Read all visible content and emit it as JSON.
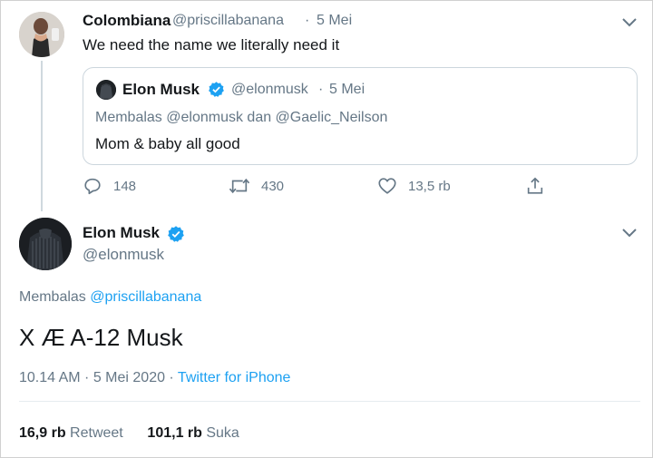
{
  "quoting_tweet": {
    "name": "Colombiana",
    "handle": "@priscillabanana",
    "separator": "·",
    "date": "5 Mei",
    "text": "We need the name we literally need it",
    "quoted": {
      "name": "Elon Musk",
      "handle": "@elonmusk",
      "separator": "·",
      "date": "5 Mei",
      "reply_context": "Membalas @elonmusk dan @Gaelic_Neilson",
      "text": "Mom & baby all good"
    },
    "actions": {
      "reply_count": "148",
      "retweet_count": "430",
      "like_count": "13,5 rb"
    }
  },
  "main_tweet": {
    "name": "Elon Musk",
    "handle": "@elonmusk",
    "reply_prefix": "Membalas",
    "reply_to": "@priscillabanana",
    "text": "X Æ A-12 Musk",
    "timestamp": "10.14 AM · 5 Mei 2020 · ",
    "source": "Twitter for iPhone",
    "retweets_value": "16,9 rb",
    "retweets_label": "Retweet",
    "likes_value": "101,1 rb",
    "likes_label": "Suka"
  },
  "icons": {
    "verified": "verified-badge-icon",
    "chevron": "chevron-down-icon",
    "reply": "reply-icon",
    "retweet": "retweet-icon",
    "like": "heart-icon",
    "share": "share-icon"
  },
  "colors": {
    "link": "#1da1f2",
    "secondary_text": "#657786",
    "primary_text": "#14171a",
    "border": "#ccd6dd"
  }
}
